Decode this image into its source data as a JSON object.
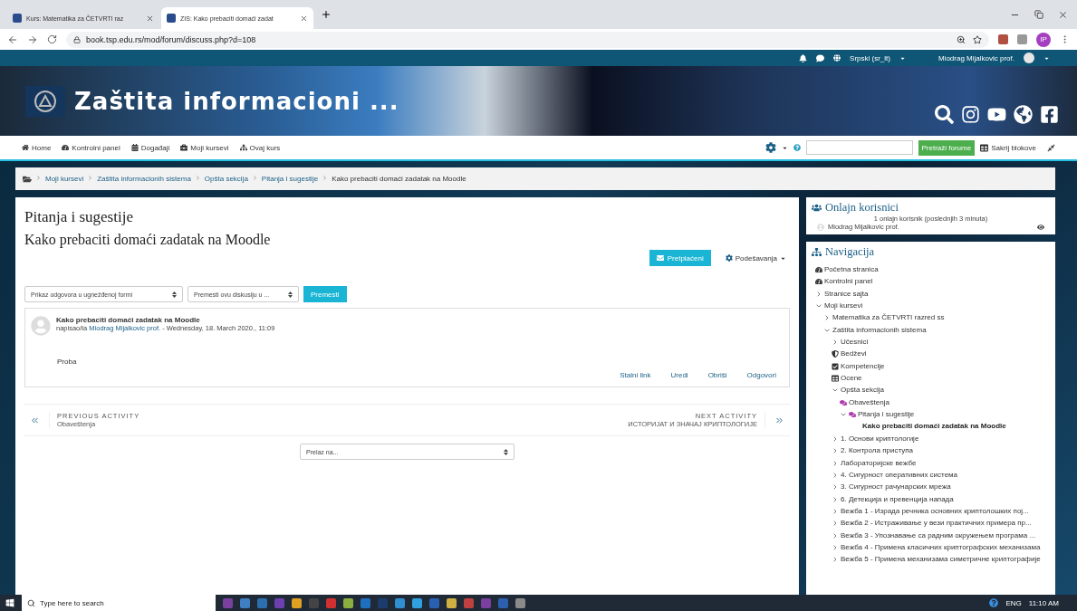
{
  "browser": {
    "tabs": [
      {
        "title": "Kurs: Matematika za ČETVRTI raz",
        "selected": false
      },
      {
        "title": "ZIS: Kako prebaciti domaći zadat",
        "selected": true
      }
    ],
    "url": "book.tsp.edu.rs/mod/forum/discuss.php?d=108",
    "profile_initials": "IP"
  },
  "topbar": {
    "language": "Srpski (sr_lt)",
    "user_name": "Miodrag Mijalkovic prof."
  },
  "banner": {
    "title": "Zaštita informacioni ..."
  },
  "nav_menu": {
    "items": [
      {
        "label": "Home",
        "kind": "home"
      },
      {
        "label": "Kontrolni panel",
        "kind": "dashboard"
      },
      {
        "label": "Događaji",
        "kind": "calendar"
      },
      {
        "label": "Moji kursevi",
        "kind": "briefcase"
      },
      {
        "label": "Ovaj kurs",
        "kind": "sitemap"
      }
    ],
    "search_button": "Pretraži forume",
    "hide_blocks": "Sakrij blokove"
  },
  "breadcrumb": [
    "Moji kursevi",
    "Zaštita informacionih sistema",
    "Opšta sekcija",
    "Pitanja i sugestije",
    "Kako prebaciti domaći zadatak na Moodle"
  ],
  "forum": {
    "title": "Pitanja i sugestije",
    "discussion_title": "Kako prebaciti domaći zadatak na Moodle",
    "subscribe_button": "Pretplaćeni",
    "settings_menu": "Podešavanja",
    "display_select": "Prikaz odgovora u ugnežđenoj formi",
    "move_select": "Premesti ovu diskusiju u ...",
    "move_button": "Premesti",
    "post": {
      "subject": "Kako prebaciti domaći zadatak na Moodle",
      "author_prefix": "napisao/la",
      "author": "Miodrag Mijalkovic prof.",
      "date": " - Wednesday, 18. March 2020., 11:09",
      "body": "Proba",
      "actions": [
        "Stalni link",
        "Uredi",
        "Obriši",
        "Odgovori"
      ]
    },
    "previous": {
      "label": "PREVIOUS ACTIVITY",
      "title": "Obaveštenja"
    },
    "next": {
      "label": "NEXT ACTIVITY",
      "title": "ИСТОРИЈАТ И ЗНАЧАЈ КРИПТОЛОГИЈЕ"
    },
    "jump_select": "Prelaz na..."
  },
  "online_block": {
    "title": "Onlajn korisnici",
    "summary": "1 onlajn korisnik (poslednjih 3 minuta)",
    "users": [
      "Miodrag Mijalkovic prof."
    ]
  },
  "navigation": {
    "title": "Navigacija",
    "tree": [
      {
        "label": "Početna stranica",
        "kind": "dashboard"
      },
      {
        "label": "Kontrolni panel",
        "kind": "dashboard"
      },
      {
        "label": "Stranice sajta",
        "kind": "branch",
        "expanded": false
      },
      {
        "label": "Moji kursevi",
        "kind": "branch",
        "expanded": true,
        "children": [
          {
            "label": "Matematika za ČETVRTI razred ss",
            "kind": "branch",
            "expanded": false
          },
          {
            "label": "Zaštita informacionih sistema",
            "kind": "branch",
            "expanded": true,
            "children": [
              {
                "label": "Učesnici",
                "kind": "branch",
                "expanded": false
              },
              {
                "label": "Bedževi",
                "kind": "badge"
              },
              {
                "label": "Kompetencije",
                "kind": "check"
              },
              {
                "label": "Ocene",
                "kind": "grades"
              },
              {
                "label": "Opšta sekcija",
                "kind": "branch",
                "expanded": true,
                "children": [
                  {
                    "label": "Obaveštenja",
                    "kind": "forum"
                  },
                  {
                    "label": "Pitanja i sugestije",
                    "kind": "forum",
                    "expanded": true,
                    "children": [
                      {
                        "label": "Kako prebaciti domaći zadatak na Moodle",
                        "kind": "current"
                      }
                    ]
                  }
                ]
              },
              {
                "label": "1. Основи криптологије",
                "kind": "branch",
                "expanded": false
              },
              {
                "label": "2. Контрола приступа",
                "kind": "branch",
                "expanded": false
              },
              {
                "label": "Лабораторијске вежбе",
                "kind": "branch",
                "expanded": false
              },
              {
                "label": "4. Сигурност оперативних система",
                "kind": "branch",
                "expanded": false
              },
              {
                "label": "3. Сигурност рачунарских мрежа",
                "kind": "branch",
                "expanded": false
              },
              {
                "label": "6. Детекција и превенција напада",
                "kind": "branch",
                "expanded": false
              },
              {
                "label": "Вежба 1 - Израда речника основних криптолошких пој...",
                "kind": "branch",
                "expanded": false
              },
              {
                "label": "Вежба 2 - Истраживање у вези практичних примера пр...",
                "kind": "branch",
                "expanded": false
              },
              {
                "label": "Вежба 3 - Упознавање са радним окружењем програма ...",
                "kind": "branch",
                "expanded": false
              },
              {
                "label": "Вежба 4 - Примена класичних криптографских механизама",
                "kind": "branch",
                "expanded": false
              },
              {
                "label": "Вежба 5 - Примена механизама симетричне криптографије",
                "kind": "branch",
                "expanded": false
              }
            ]
          }
        ]
      }
    ]
  },
  "taskbar": {
    "search_placeholder": "Type here to search",
    "language": "ENG",
    "time": "11:10 AM"
  }
}
